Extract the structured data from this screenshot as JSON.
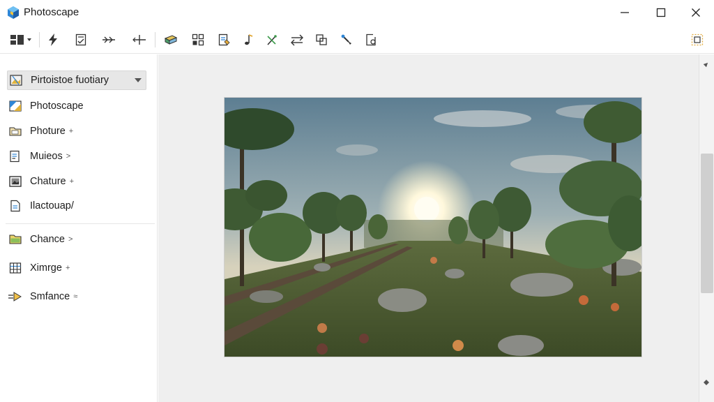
{
  "window": {
    "title": "Photoscape",
    "controls": {
      "minimize": "minimize-icon",
      "maximize": "maximize-icon",
      "close": "close-icon"
    }
  },
  "toolbar": {
    "icons": [
      "layout-dropdown-icon",
      "flash-icon",
      "checklist-icon",
      "arrows-icon",
      "split-icon",
      "stack-icon",
      "grid-icon",
      "edit-document-icon",
      "music-note-icon",
      "magic-wand-icon",
      "swap-icon",
      "crop-icon",
      "brush-icon",
      "document-settings-icon",
      "selection-grid-icon"
    ]
  },
  "sidebar": {
    "items": [
      {
        "label": "Pirtoistoe fuotiary",
        "suffix": "",
        "icon": "photo-editor-icon",
        "selected": true
      },
      {
        "label": "Photoscape",
        "suffix": "",
        "icon": "photoscape-icon",
        "selected": false
      },
      {
        "label": "Photure",
        "suffix": "+",
        "icon": "folder-photo-icon",
        "selected": false
      },
      {
        "label": "Muieos",
        "suffix": ">",
        "icon": "document-edit-icon",
        "selected": false
      },
      {
        "label": "Chature",
        "suffix": "+",
        "icon": "picture-frame-icon",
        "selected": false
      },
      {
        "label": "Ilactouap/",
        "suffix": "",
        "icon": "page-icon",
        "selected": false
      },
      {
        "label": "Chance",
        "suffix": ">",
        "icon": "folder-green-icon",
        "selected": false
      },
      {
        "label": "Ximrge",
        "suffix": "+",
        "icon": "grid-sheet-icon",
        "selected": false
      },
      {
        "label": "Smfance",
        "suffix": "≈",
        "icon": "slideshow-icon",
        "selected": false
      }
    ]
  },
  "canvas": {
    "image": "forest-scene-image"
  },
  "colors": {
    "accent": "#2f86d6",
    "sidebar_selected": "#e7e7e7",
    "canvas_bg": "#efefef"
  }
}
